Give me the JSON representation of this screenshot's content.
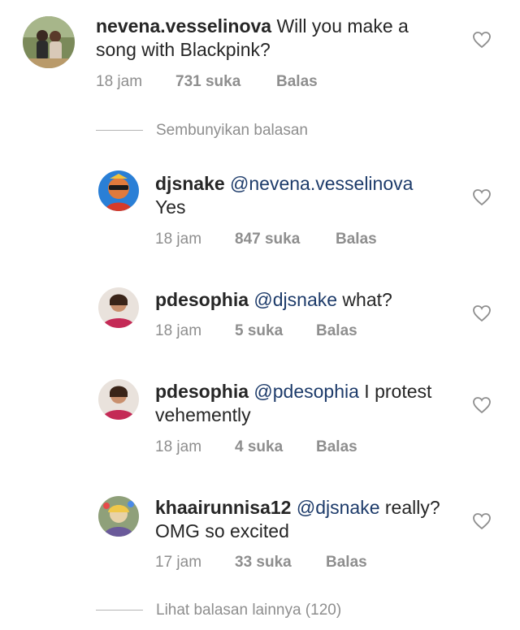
{
  "comments": [
    {
      "username": "nevena.vesselinova",
      "mention": "",
      "text": " Will you make a song with Blackpink?",
      "time": "18 jam",
      "likes": "731 suka",
      "reply": "Balas",
      "avatar_icon": "user-photo-avatar"
    },
    {
      "username": "djsnake",
      "mention": "@nevena.vesselinova",
      "text": "Yes",
      "time": "18 jam",
      "likes": "847 suka",
      "reply": "Balas",
      "avatar_icon": "user-photo-avatar"
    },
    {
      "username": "pdesophia",
      "mention": "@djsnake",
      "text": " what?",
      "time": "18 jam",
      "likes": "5 suka",
      "reply": "Balas",
      "avatar_icon": "user-photo-avatar"
    },
    {
      "username": "pdesophia",
      "mention": "@pdesophia",
      "text": " I protest vehemently",
      "time": "18 jam",
      "likes": "4 suka",
      "reply": "Balas",
      "avatar_icon": "user-photo-avatar"
    },
    {
      "username": "khaairunnisa12",
      "mention": "@djsnake",
      "text": " really? OMG so excited",
      "time": "17 jam",
      "likes": "33 suka",
      "reply": "Balas",
      "avatar_icon": "user-photo-avatar"
    }
  ],
  "hide_replies_label": "Sembunyikan balasan",
  "view_more_replies_label": "Lihat balasan lainnya (120)",
  "colors": {
    "text": "#262626",
    "secondary": "#8e8e8e",
    "mention": "#1d3b6a"
  }
}
